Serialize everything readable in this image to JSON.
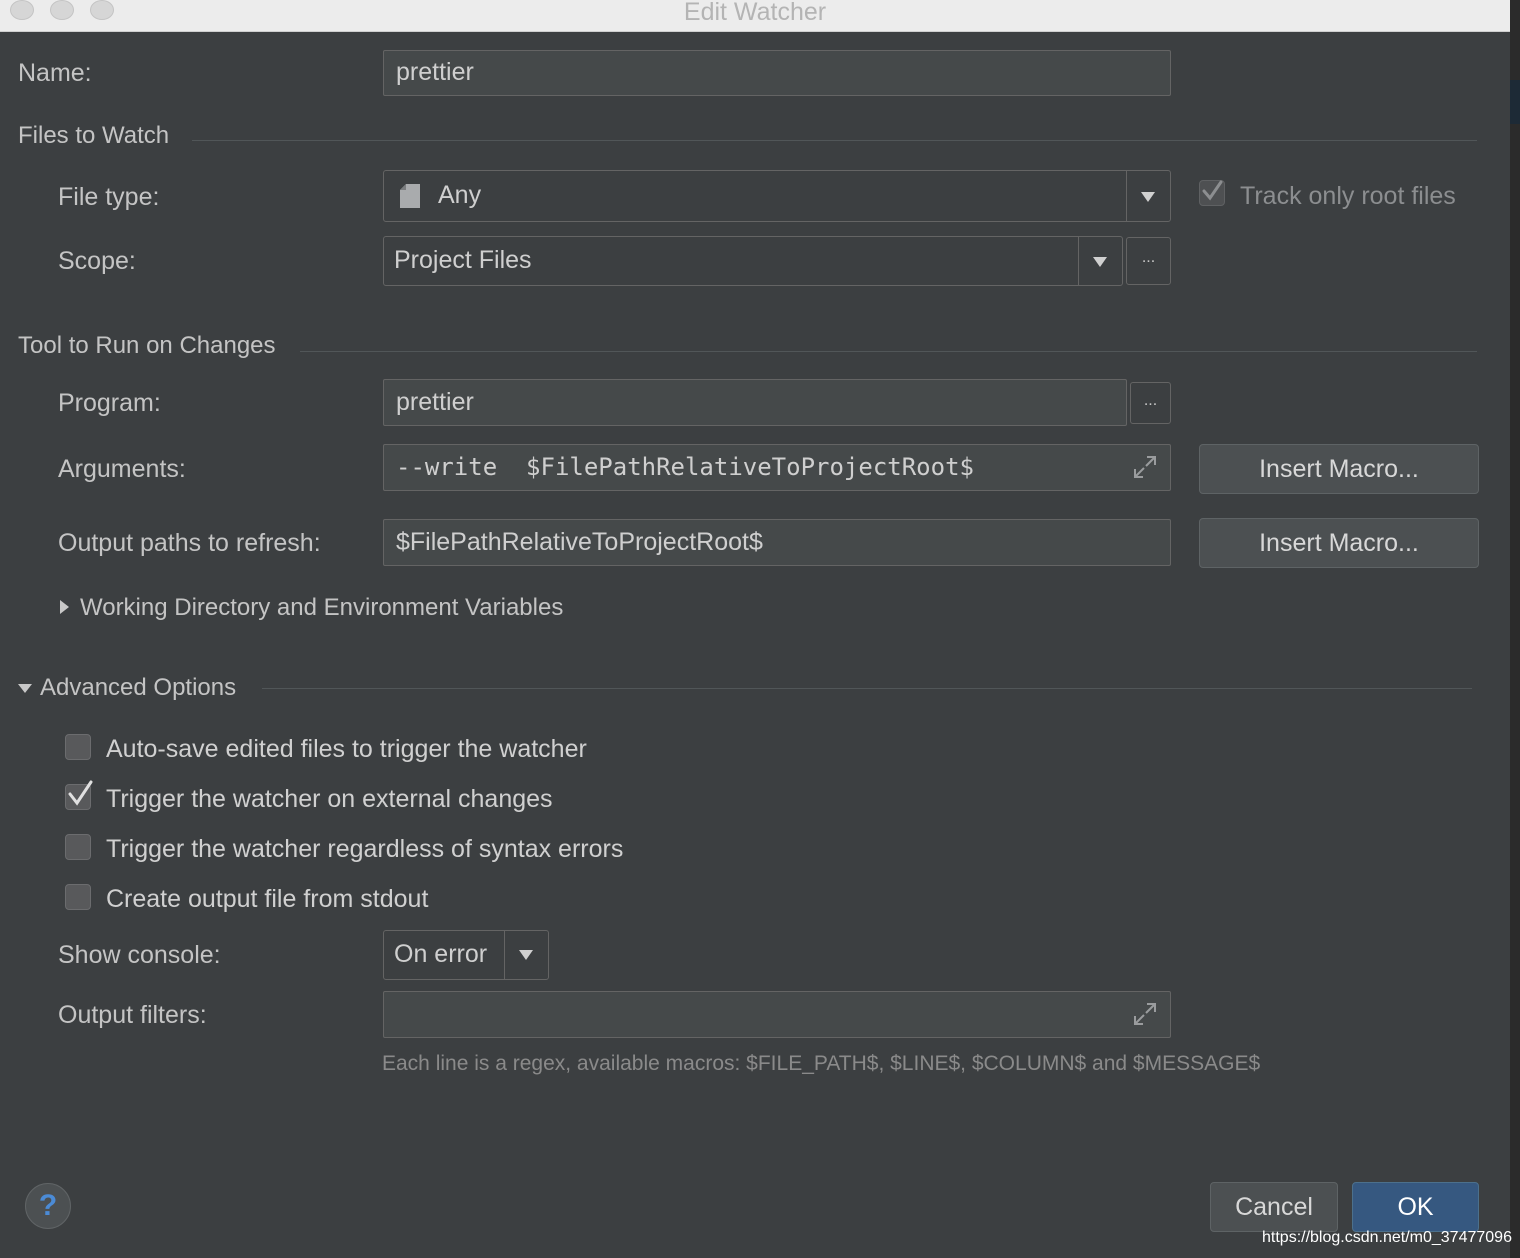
{
  "window": {
    "title": "Edit Watcher"
  },
  "name": {
    "label": "Name:",
    "value": "prettier"
  },
  "files_to_watch": {
    "heading": "Files to Watch",
    "file_type_label": "File type:",
    "file_type_value": "Any",
    "track_root_label": "Track only root files",
    "track_root_checked": true,
    "scope_label": "Scope:",
    "scope_value": "Project Files",
    "scope_more": "..."
  },
  "tool": {
    "heading": "Tool to Run on Changes",
    "program_label": "Program:",
    "program_value": "prettier",
    "program_more": "...",
    "arguments_label": "Arguments:",
    "arguments_value": "--write  $FilePathRelativeToProjectRoot$",
    "insert_macro_1": "Insert Macro...",
    "output_paths_label": "Output paths to refresh:",
    "output_paths_value": "$FilePathRelativeToProjectRoot$",
    "insert_macro_2": "Insert Macro...",
    "working_dir_label": "Working Directory and Environment Variables"
  },
  "advanced": {
    "heading": "Advanced Options",
    "options": [
      {
        "label": "Auto-save edited files to trigger the watcher",
        "checked": false
      },
      {
        "label": "Trigger the watcher on external changes",
        "checked": true
      },
      {
        "label": "Trigger the watcher regardless of syntax errors",
        "checked": false
      },
      {
        "label": "Create output file from stdout",
        "checked": false
      }
    ],
    "show_console_label": "Show console:",
    "show_console_value": "On error",
    "output_filters_label": "Output filters:",
    "output_filters_value": "",
    "hint": "Each line is a regex, available macros: $FILE_PATH$, $LINE$, $COLUMN$ and $MESSAGE$"
  },
  "footer": {
    "help": "?",
    "cancel": "Cancel",
    "ok": "OK"
  },
  "watermark": "https://blog.csdn.net/m0_37477096"
}
